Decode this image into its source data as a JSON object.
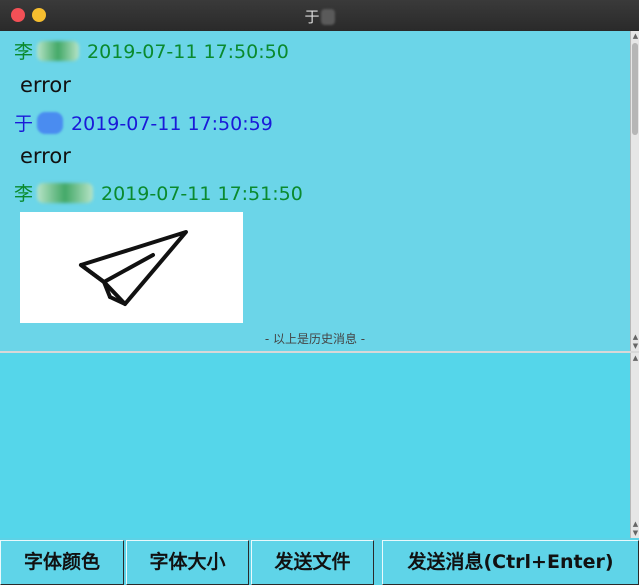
{
  "window": {
    "title": "于"
  },
  "history": {
    "messages": [
      {
        "sender": "李",
        "timestamp": "2019-07-11 17:50:50",
        "body": "error",
        "color": "#0a8a2e"
      },
      {
        "sender": "于",
        "timestamp": "2019-07-11 17:50:59",
        "body": "error",
        "color": "#1a1ad8"
      },
      {
        "sender": "李",
        "timestamp": "2019-07-11 17:51:50",
        "image": "paper-plane-icon",
        "color": "#0a8a2e"
      }
    ],
    "note": "- 以上是历史消息 -"
  },
  "input": {
    "value": ""
  },
  "buttons": {
    "font_color": "字体颜色",
    "font_size": "字体大小",
    "send_file": "发送文件",
    "send_message": "发送消息(Ctrl+Enter)"
  },
  "colors": {
    "history_bg": "#6bd5e8",
    "input_bg": "#55d6ea",
    "sender_green": "#0a8a2e",
    "sender_blue": "#1a1ad8"
  }
}
